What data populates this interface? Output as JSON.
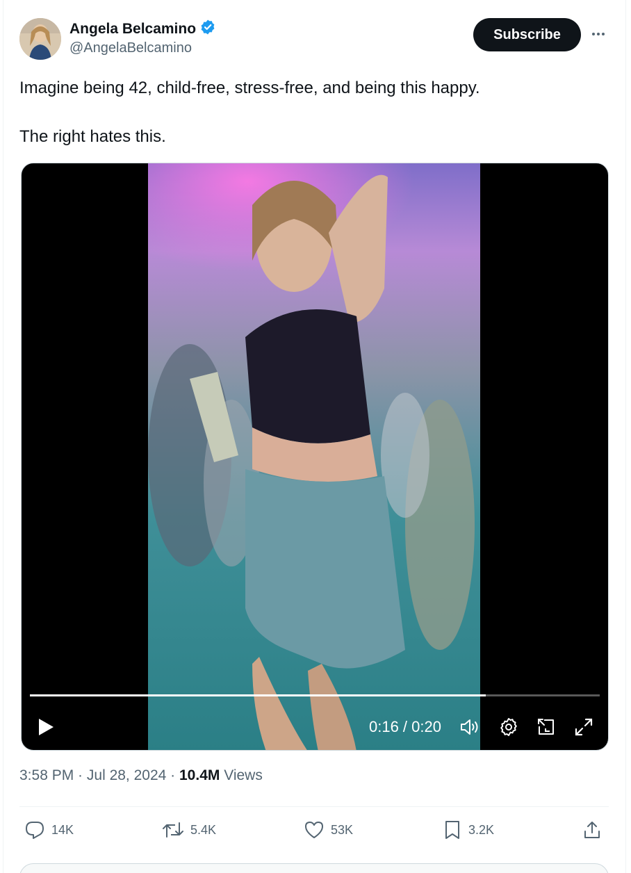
{
  "author": {
    "name": "Angela Belcamino",
    "handle": "@AngelaBelcamino",
    "verified": true
  },
  "header": {
    "subscribe_label": "Subscribe",
    "more_icon": "more-horizontal-icon"
  },
  "tweet": {
    "line1": "Imagine being 42, child-free, stress-free, and being this happy.",
    "line2": "The right hates this."
  },
  "video": {
    "time_display": "0:16 / 0:20",
    "progress_fraction": 0.8,
    "controls": [
      "play-icon",
      "volume-icon",
      "settings-icon",
      "picture-in-picture-icon",
      "fullscreen-icon"
    ]
  },
  "meta": {
    "time": "3:58 PM",
    "sep1": " · ",
    "date": "Jul 28, 2024",
    "sep2": " · ",
    "views_count": "10.4M",
    "views_label": " Views"
  },
  "actions": {
    "replies": "14K",
    "reposts": "5.4K",
    "likes": "53K",
    "bookmarks": "3.2K"
  },
  "colors": {
    "verified_blue": "#1d9bf0",
    "text_primary": "#0f1419",
    "text_secondary": "#536471",
    "button_dark": "#0f1419"
  }
}
